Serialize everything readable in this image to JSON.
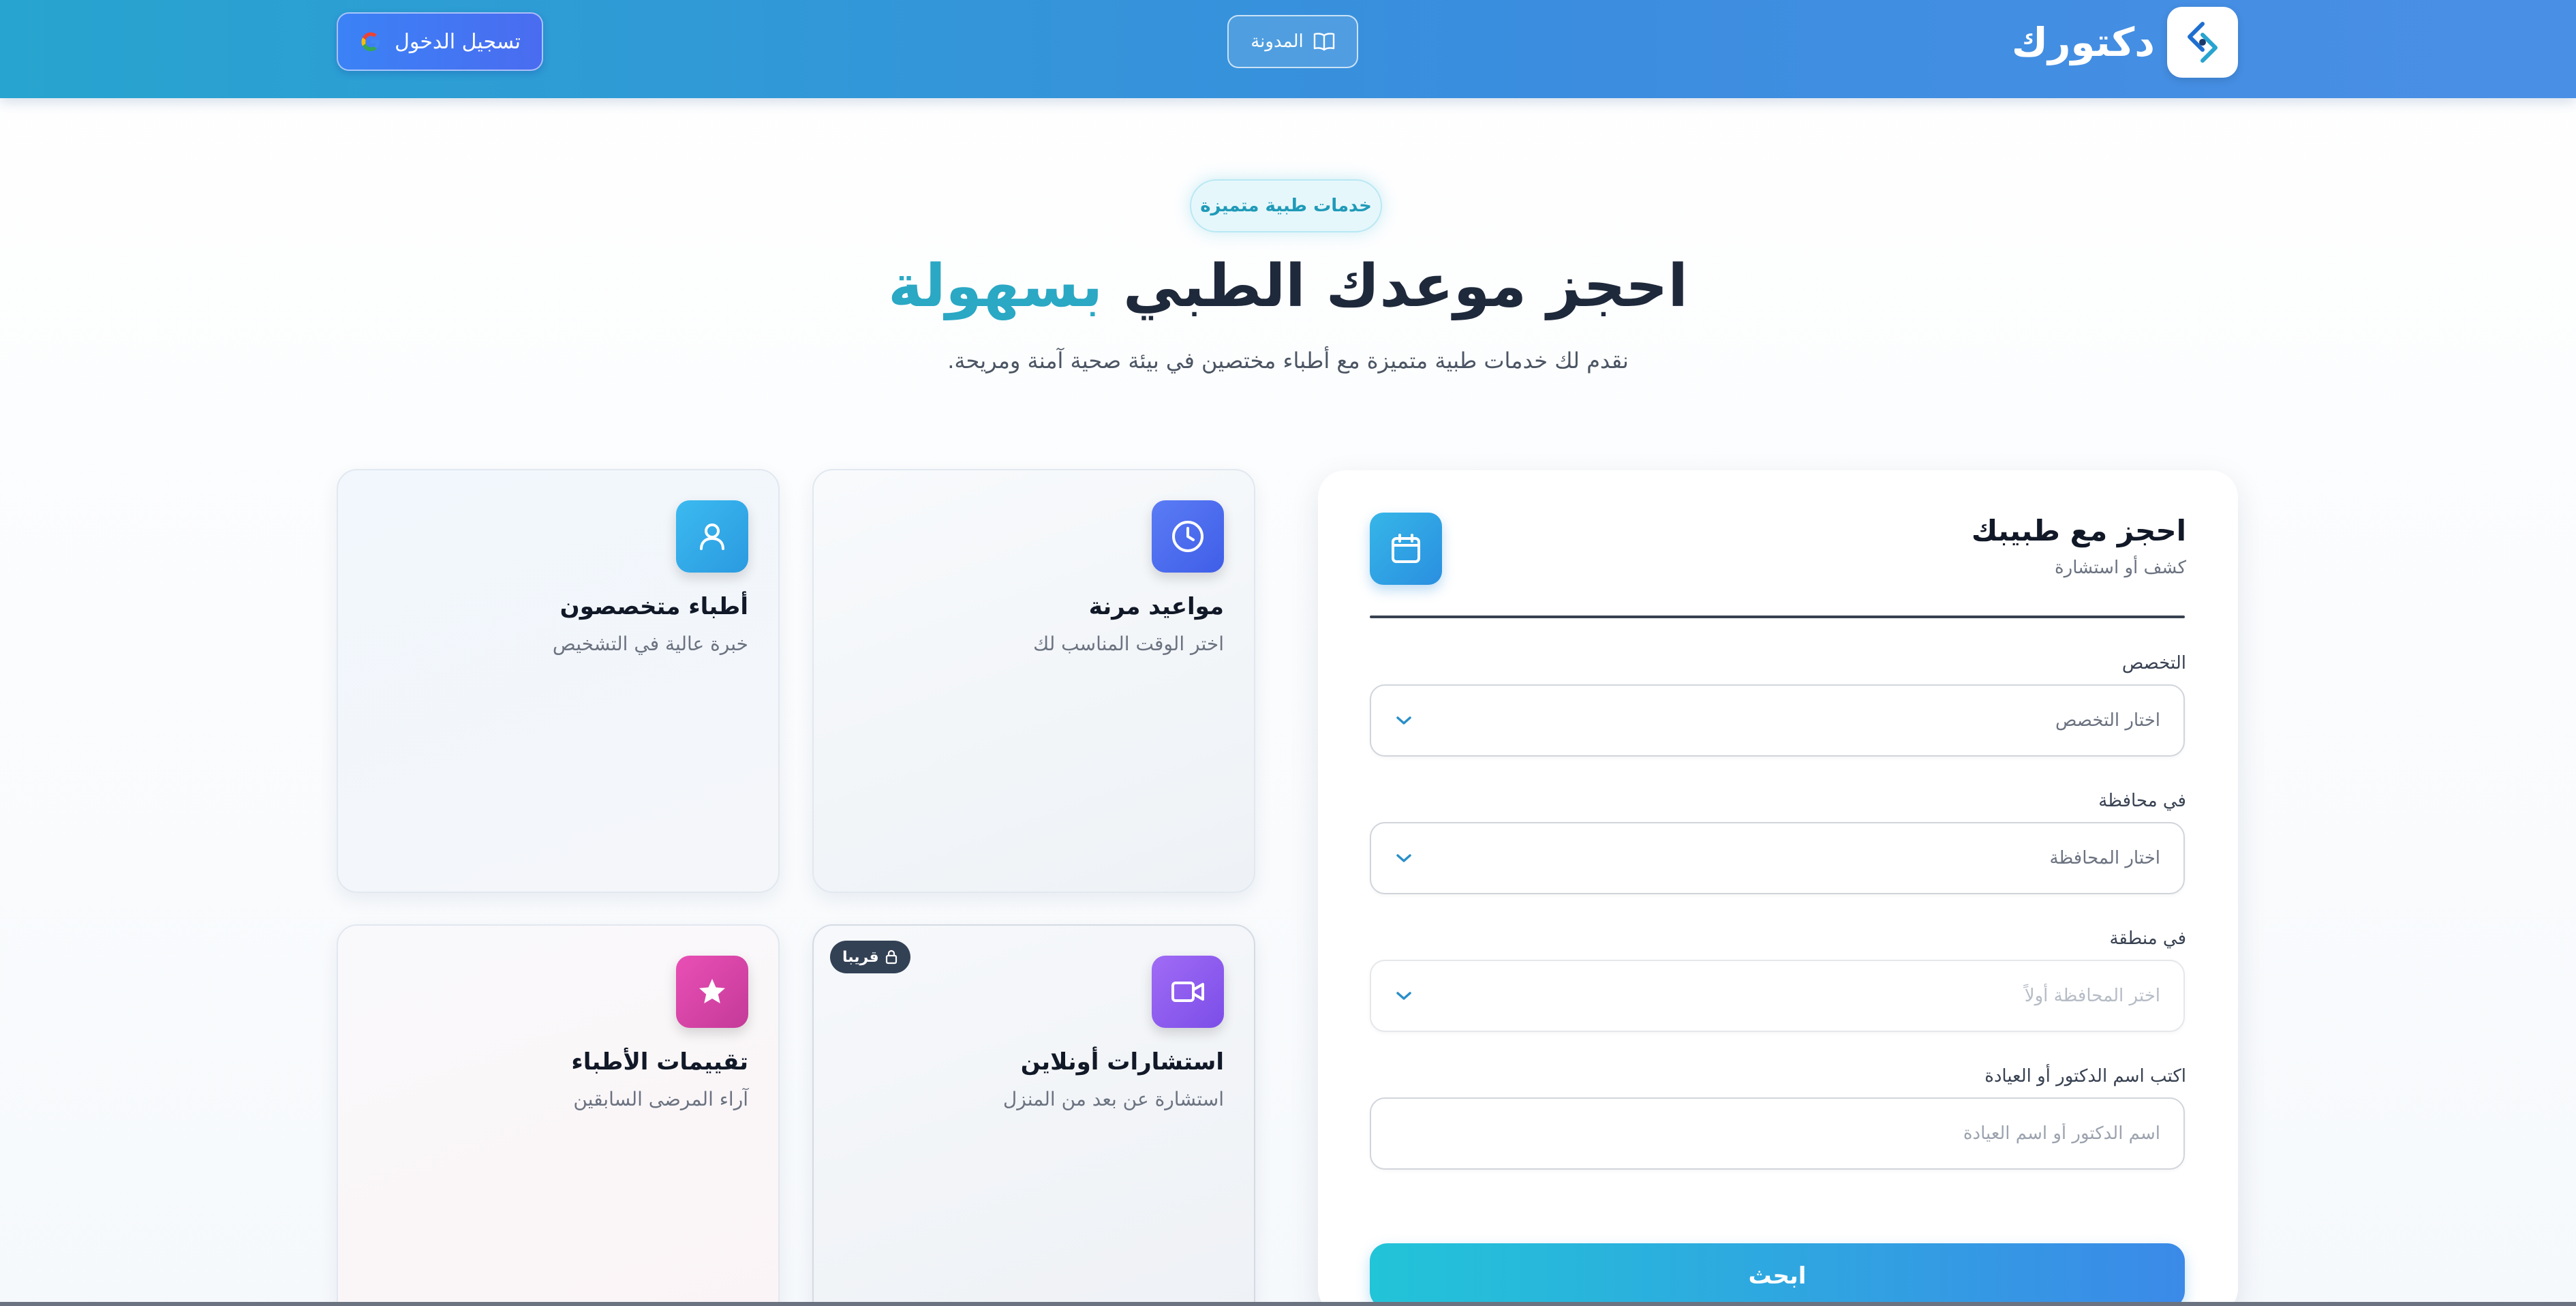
{
  "header": {
    "brand_name": "دكتورك",
    "blog_label": "المدونة",
    "login_label": "تسجيل الدخول"
  },
  "hero": {
    "badge": "خدمات طبية متميزة",
    "title_main": "احجز موعدك الطبي ",
    "title_accent": "بسهولة",
    "subtitle": "نقدم لك خدمات طبية متميزة مع أطباء مختصين في بيئة صحية آمنة ومريحة."
  },
  "features": [
    {
      "title": "مواعيد مرنة",
      "desc": "اختر الوقت المناسب لك",
      "icon": "clock-icon",
      "color": "#4f6ff0"
    },
    {
      "title": "أطباء متخصصون",
      "desc": "خبرة عالية في التشخيص",
      "icon": "user-icon",
      "color": "#2eaae6"
    },
    {
      "title": "استشارات أونلاين",
      "desc": "استشارة عن بعد من المنزل",
      "icon": "video-icon",
      "color": "#8b5cf6",
      "badge": "قريبا"
    },
    {
      "title": "تقييمات الأطباء",
      "desc": "آراء المرضى السابقين",
      "icon": "star-icon",
      "color": "#d946a8"
    }
  ],
  "booking": {
    "title": "احجز مع طبيبك",
    "subtitle": "كشف أو استشارة",
    "specialty_label": "التخصص",
    "specialty_value": "اختار التخصص",
    "governorate_label": "في محافظة",
    "governorate_value": "اختار المحافظة",
    "area_label": "في منطقة",
    "area_value": "اختر المحافظة أولاً",
    "name_label": "اكتب اسم الدكتور أو العيادة",
    "name_placeholder": "اسم الدكتور أو اسم العيادة",
    "search_label": "ابحث"
  },
  "colors": {
    "header_start": "#27a4cf",
    "header_end": "#4a8fe6",
    "accent": "#2aa8c4"
  }
}
